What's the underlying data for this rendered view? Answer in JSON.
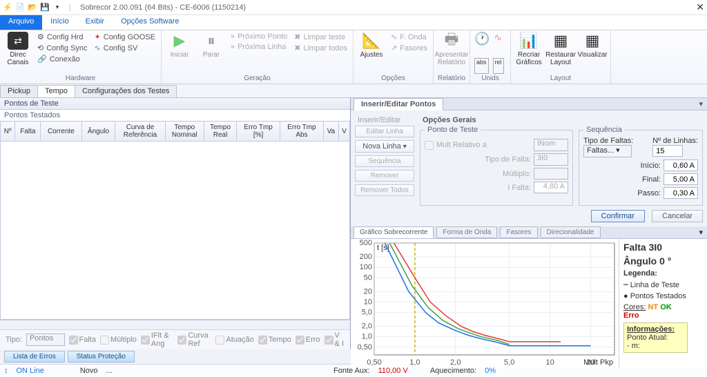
{
  "title": "Sobrecor 2.00.091 (64 Bits) - CE-6006 (1150214)",
  "menu": {
    "arquivo": "Arquivo",
    "inicio": "Início",
    "exibir": "Exibir",
    "opcoes": "Opções Software"
  },
  "ribbon": {
    "hardware": {
      "label": "Hardware",
      "direcCanais": "Direc\nCanais",
      "configHrd": "Config Hrd",
      "configSync": "Config Sync",
      "conexao": "Conexão",
      "configGoose": "Config GOOSE",
      "configSv": "Config SV"
    },
    "geracao": {
      "label": "Geração",
      "iniciar": "Iniciar",
      "parar": "Parar",
      "proximoPonto": "Próximo Ponto",
      "proximaLinha": "Próxima Linha",
      "limparTeste": "Limpar teste",
      "limparTodos": "Limpar todos"
    },
    "opcoes": {
      "label": "Opções",
      "ajustes": "Ajustes",
      "fOnda": "F. Onda",
      "fasores": "Fasores"
    },
    "relatorio": {
      "label": "Relatório",
      "apresentar": "Apresentar\nRelatório"
    },
    "unids": {
      "label": "Unids"
    },
    "layout": {
      "label": "Layout",
      "recriar": "Recriar\nGráficos",
      "restaurar": "Restaurar\nLayout",
      "visualizar": "Visualizar"
    }
  },
  "subtabs": {
    "pickup": "Pickup",
    "tempo": "Tempo",
    "config": "Configurações dos Testes"
  },
  "pontosTeste": {
    "head": "Pontos de Teste",
    "sub": "Pontos Testados"
  },
  "gridCols": [
    "Nº",
    "Falta",
    "Corrente",
    "Ângulo",
    "Curva de\nReferência",
    "Tempo\nNominal",
    "Tempo\nReal",
    "Erro Tmp\n[%]",
    "Erro Tmp\nAbs",
    "Va",
    "V"
  ],
  "footer": {
    "tipo": "Tipo:",
    "tipoVal": "Pontos",
    "falta": "Falta",
    "multiplo": "Múltiplo",
    "iflt": "IFlt & Ang",
    "curvaRef": "Curva Ref",
    "atuacao": "Atuação",
    "tempo": "Tempo",
    "erro": "Erro",
    "vei": "V & I"
  },
  "btabs": {
    "lista": "Lista de Erros",
    "status": "Status Proteção"
  },
  "statusbar": {
    "online": "ON Line",
    "novo": "Novo",
    "dots": "...",
    "fonteLabel": "Fonte Aux:",
    "fonteVal": "110,00 V",
    "aqueLabel": "Aquecimento:",
    "aqueVal": "0%"
  },
  "insert": {
    "title": "Inserir/Editar Pontos",
    "insEdit": "Inserir/Editar",
    "opGerais": "Opções Gerais",
    "buttons": {
      "editar": "Editar Linha",
      "nova": "Nova Linha",
      "seq": "Sequência",
      "remover": "Remover",
      "removerTodos": "Remover Todos"
    },
    "pontoTeste": "Ponto de Teste",
    "multRel": "Mult Relativo a",
    "iNom": "INom",
    "tipoFalta": "Tipo de Falta:",
    "tipoFaltaVal": "3I0",
    "multiplo": "Múltiplo:",
    "iFalta": "I Falta:",
    "iFaltaVal": "4,80 A",
    "seqTitle": "Sequência",
    "tipoFaltas": "Tipo de Faltas:",
    "tipoFaltasVal": "Faltas...",
    "nLinhas": "Nº de Linhas:",
    "nLinhasVal": "15",
    "inicio": "Início:",
    "inicioVal": "0,60 A",
    "final": "Final:",
    "finalVal": "5,00 A",
    "passo": "Passo:",
    "passoVal": "0,30 A",
    "confirmar": "Confirmar",
    "cancelar": "Cancelar"
  },
  "charttabs": {
    "graf": "Gráfico Sobrecorrente",
    "forma": "Forma de Onda",
    "fasores": "Fasores",
    "direc": "Direcionalidade"
  },
  "legend": {
    "falta": "Falta 3I0",
    "angulo": "Ângulo 0 °",
    "legenda": "Legenda:",
    "linha": "Linha de Teste",
    "pontos": "Pontos Testados",
    "cores": "Cores:",
    "nt": "NT",
    "ok": "OK",
    "erro": "Erro",
    "info": "Informações:",
    "pontoAtual": "Ponto Atual:",
    "m": "- m:"
  },
  "chart_data": {
    "type": "line",
    "xlabel": "Mult Pkp",
    "ylabel": "t [s]",
    "xlim": [
      0.5,
      30
    ],
    "ylim": [
      0.3,
      500
    ],
    "xscale": "log",
    "yscale": "log",
    "x_ticks": [
      0.5,
      1,
      2,
      5,
      10,
      20
    ],
    "x_tick_labels": [
      "0,50",
      "1,0",
      "2,0",
      "5,0",
      "10",
      "20"
    ],
    "y_ticks": [
      0.5,
      1,
      2,
      5,
      10,
      20,
      50,
      100,
      200,
      500
    ],
    "y_tick_labels": [
      "0,50",
      "1,0",
      "2,0",
      "5,0",
      "10",
      "20",
      "50",
      "100",
      "200",
      "500"
    ],
    "series": [
      {
        "name": "blue",
        "color": "#1a73e8",
        "x": [
          0.6,
          0.9,
          1.2,
          1.5,
          2.0,
          2.5,
          3.0,
          4.0,
          5.0,
          20
        ],
        "y": [
          500,
          20,
          5,
          2.5,
          1.5,
          1.1,
          0.9,
          0.7,
          0.55,
          0.55
        ]
      },
      {
        "name": "red",
        "color": "#e53935",
        "x": [
          0.7,
          1.0,
          1.3,
          1.7,
          2.2,
          2.7,
          3.3,
          4.3,
          5.0,
          12
        ],
        "y": [
          500,
          50,
          10,
          4,
          2.0,
          1.4,
          1.1,
          0.85,
          0.72,
          0.72
        ]
      },
      {
        "name": "green",
        "color": "#43a047",
        "x": [
          0.65,
          0.95,
          1.25,
          1.6,
          2.1,
          2.6,
          3.1,
          4.1,
          5.0
        ],
        "y": [
          500,
          30,
          7,
          3,
          1.7,
          1.25,
          1.0,
          0.78,
          0.6
        ]
      }
    ],
    "test_line_x": 1.0
  }
}
